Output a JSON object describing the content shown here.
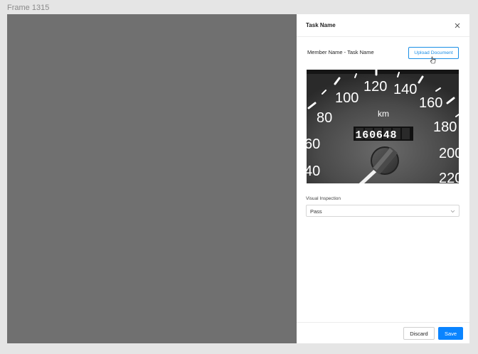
{
  "frame": {
    "label": "Frame 1315"
  },
  "panel": {
    "title": "Task Name",
    "member_task_label": "Member Name - Task Name",
    "upload_button": "Upload Document",
    "document_image": {
      "description": "speedometer photo",
      "dial_labels": [
        "80",
        "100",
        "120",
        "140",
        "160",
        "180",
        "200",
        "220",
        "60",
        "40"
      ],
      "unit": "km",
      "odometer": "160648"
    },
    "visual_inspection": {
      "label": "Visual Inspection",
      "selected": "Pass"
    },
    "footer": {
      "discard_label": "Discard",
      "save_label": "Save"
    }
  },
  "colors": {
    "accent": "#0a84ff",
    "overlay": "#707070",
    "background": "#e5e5e5"
  },
  "icons": [
    "close-icon",
    "cursor-icon",
    "chevron-down-icon"
  ]
}
